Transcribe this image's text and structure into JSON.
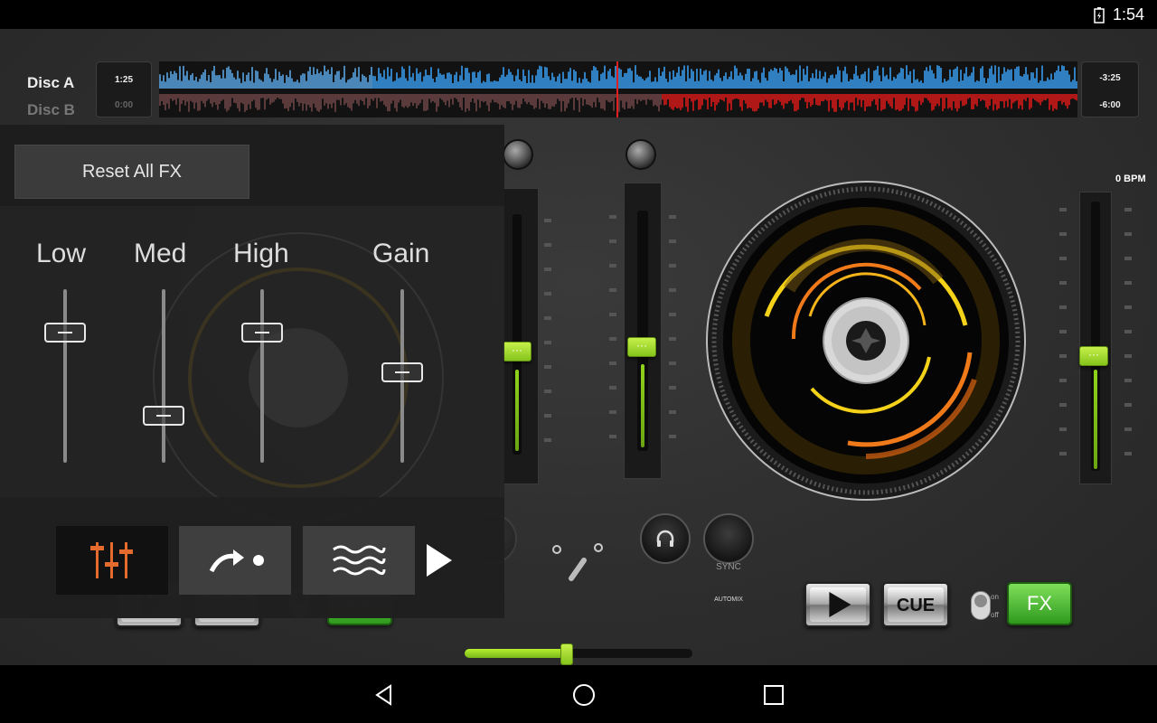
{
  "status_bar": {
    "time": "1:54",
    "battery_icon": "battery-charging-icon"
  },
  "header": {
    "disc_a_label": "Disc A",
    "disc_b_label": "Disc B",
    "disc_a_elapsed": "1:25",
    "disc_b_elapsed": "0:00",
    "disc_a_remaining": "-3:25",
    "disc_b_remaining": "-6:00",
    "disc_a_color": "#2f7fc1",
    "disc_b_color": "#b01717"
  },
  "deck_b": {
    "bpm": "0 BPM"
  },
  "fx_panel": {
    "reset_label": "Reset All FX",
    "eq_bands": [
      {
        "label": "Low",
        "level": 0.75
      },
      {
        "label": "Med",
        "level": 0.27
      },
      {
        "label": "High",
        "level": 0.75
      },
      {
        "label": "Gain",
        "level": 0.52
      }
    ],
    "tabs": [
      {
        "name": "eq",
        "icon": "equalizer-icon",
        "selected": true
      },
      {
        "name": "delay",
        "icon": "delay-arrow-icon",
        "selected": false
      },
      {
        "name": "flanger",
        "icon": "waves-icon",
        "selected": false
      }
    ],
    "next_icon": "play-next-icon"
  },
  "transport": {
    "cue_label": "CUE",
    "fx_label": "FX",
    "toggle_on": "on",
    "toggle_off": "off",
    "sync_label": "SYNC",
    "automix_label": "AUTOMIX"
  },
  "mixer": {
    "crossfader_position": 0.45
  },
  "colors": {
    "accent_green": "#8fd21b",
    "fx_green": "#4cbf33",
    "platter_orange": "#f07a1a",
    "platter_yellow": "#f5d21a"
  }
}
